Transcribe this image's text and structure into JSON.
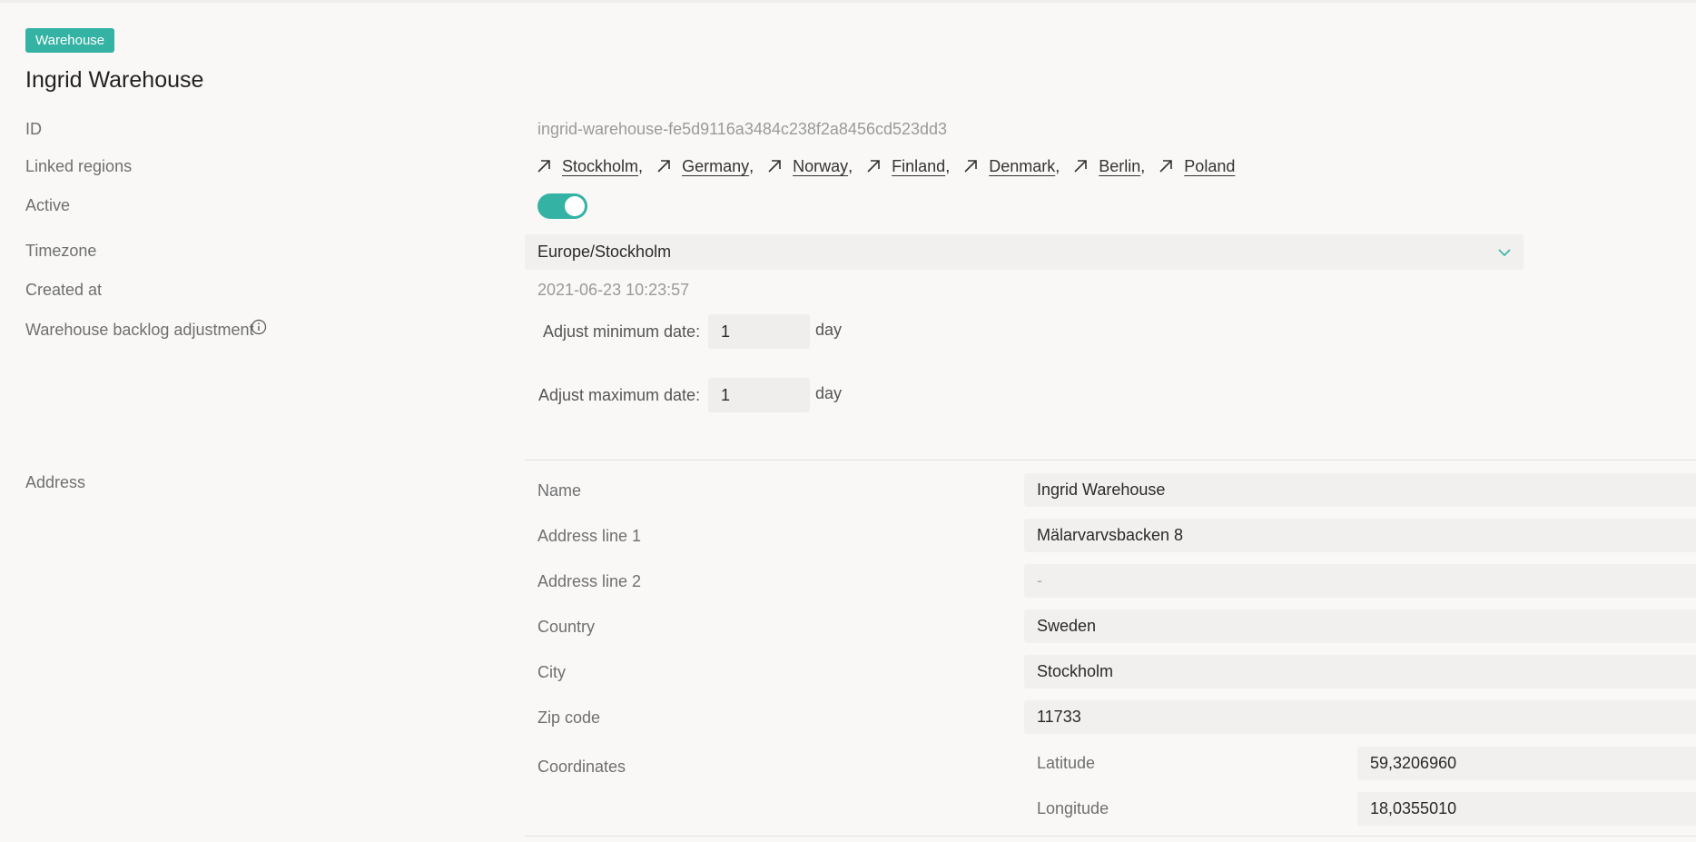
{
  "badge": "Warehouse",
  "title": "Ingrid Warehouse",
  "labels": {
    "id": "ID",
    "linked_regions": "Linked regions",
    "active": "Active",
    "timezone": "Timezone",
    "created_at": "Created at",
    "backlog": "Warehouse backlog adjustment",
    "address": "Address"
  },
  "id_value": "ingrid-warehouse-fe5d9116a3484c238f2a8456cd523dd3",
  "regions": [
    {
      "name": "Stockholm",
      "sep": ","
    },
    {
      "name": "Germany",
      "sep": ","
    },
    {
      "name": "Norway",
      "sep": ","
    },
    {
      "name": "Finland",
      "sep": ","
    },
    {
      "name": "Denmark",
      "sep": ","
    },
    {
      "name": "Berlin",
      "sep": ","
    },
    {
      "name": "Poland",
      "sep": ""
    }
  ],
  "active": true,
  "timezone": "Europe/Stockholm",
  "created_at": "2021-06-23 10:23:57",
  "backlog": {
    "min_label": "Adjust minimum date:",
    "min_value": "1",
    "max_label": "Adjust maximum date:",
    "max_value": "1",
    "unit": "day"
  },
  "address": {
    "name_label": "Name",
    "name": "Ingrid Warehouse",
    "line1_label": "Address line 1",
    "line1": "Mälarvarvsbacken 8",
    "line2_label": "Address line 2",
    "line2": "-",
    "country_label": "Country",
    "country": "Sweden",
    "city_label": "City",
    "city": "Stockholm",
    "zip_label": "Zip code",
    "zip": "11733",
    "coords_label": "Coordinates",
    "lat_label": "Latitude",
    "lat": "59,3206960",
    "lng_label": "Longitude",
    "lng": "18,0355010"
  },
  "colors": {
    "accent": "#34b3a4",
    "background": "#f9f8f7",
    "field": "#f1f0ee"
  },
  "icons": {
    "region": "arrow-up-right-icon",
    "info": "info-icon",
    "dropdown": "chevron-down-icon"
  }
}
